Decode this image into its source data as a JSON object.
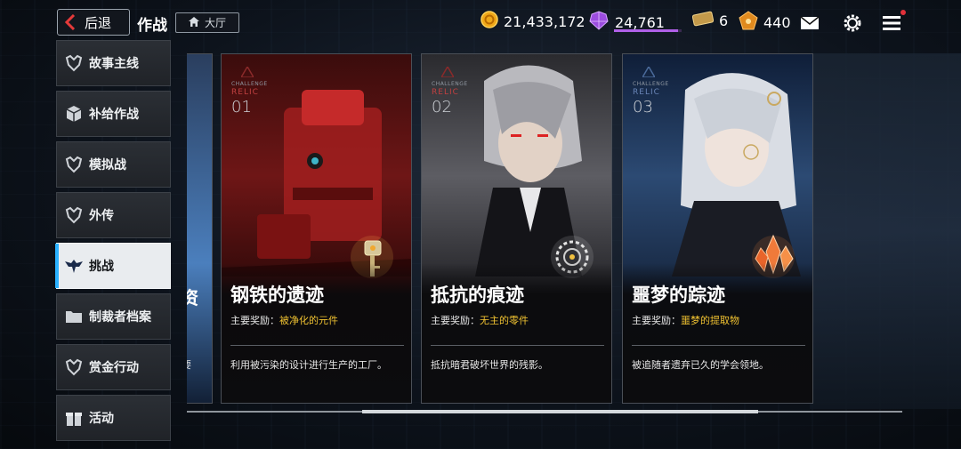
{
  "header": {
    "back_label": "后退",
    "title": "作战",
    "lobby_label": "大厅"
  },
  "resources": {
    "coin": "21,433,172",
    "gem": "24,761",
    "gem_bar_fraction": 0.95,
    "ticket": "6",
    "chest": "440"
  },
  "sidebar": {
    "items": [
      {
        "label": "故事主线",
        "icon": "mech-icon",
        "active": false
      },
      {
        "label": "补给作战",
        "icon": "cube-icon",
        "active": false
      },
      {
        "label": "模拟战",
        "icon": "mech-icon",
        "active": false
      },
      {
        "label": "外传",
        "icon": "mech-icon",
        "active": false
      },
      {
        "label": "挑战",
        "icon": "eagle-icon",
        "active": true
      },
      {
        "label": "制裁者档案",
        "icon": "folder-icon",
        "active": false
      },
      {
        "label": "赏金行动",
        "icon": "mech-icon",
        "active": false
      },
      {
        "label": "活动",
        "icon": "gift-icon",
        "active": false
      }
    ]
  },
  "partial_card": {
    "name_fragment": "资",
    "text_fragment": "要"
  },
  "cards": [
    {
      "challenge_label": "CHALLENGE",
      "relic_label": "RELIC",
      "number": "01",
      "name": "钢铁的遗迹",
      "reward_prefix": "主要奖励：",
      "reward_value": "被净化的元件",
      "description": "利用被污染的设计进行生产的工厂。"
    },
    {
      "challenge_label": "CHALLENGE",
      "relic_label": "RELIC",
      "number": "02",
      "name": "抵抗的痕迹",
      "reward_prefix": "主要奖励：",
      "reward_value": "无主的零件",
      "description": "抵抗暗君破坏世界的残影。"
    },
    {
      "challenge_label": "CHALLENGE",
      "relic_label": "RELIC",
      "number": "03",
      "name": "噩梦的踪迹",
      "reward_prefix": "主要奖励：",
      "reward_value": "噩梦的提取物",
      "description": "被追随者遗弃已久的学会领地。"
    }
  ],
  "scroll": {
    "position_fraction": 0.55
  }
}
